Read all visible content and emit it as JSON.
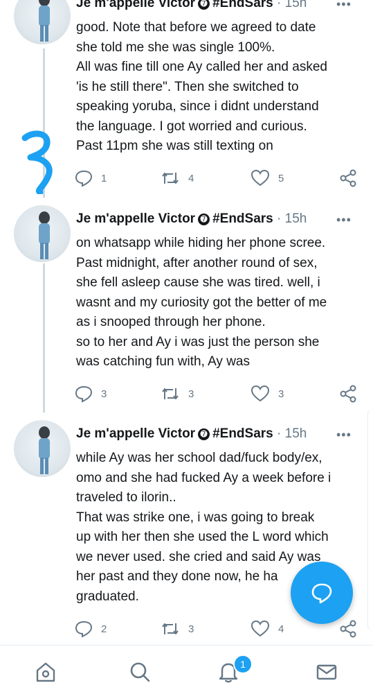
{
  "tweets": [
    {
      "name": "Je m'appelle Victor",
      "tag": "#EndSars",
      "sep": "·",
      "time": "15h",
      "lines": [
        "good. Note that before we agreed to date",
        "she told me she was single 100%.",
        "All was fine till one Ay called her and asked",
        "'is he still there\". Then she switched to",
        "speaking yoruba, since i didnt understand",
        "the language. I got worried and curious.",
        "Past 11pm she was still texting on"
      ],
      "replies": "1",
      "retweets": "4",
      "likes": "5"
    },
    {
      "name": "Je m'appelle Victor",
      "tag": "#EndSars",
      "sep": "·",
      "time": "15h",
      "lines": [
        "on whatsapp while hiding her phone scree.",
        "Past midnight, after another round of sex,",
        "she fell asleep cause she was tired. well, i",
        "wasnt and my curiosity got the better of me",
        "as i snooped through her phone.",
        "so to her and Ay i was just the person she",
        "was catching fun with, Ay was"
      ],
      "replies": "3",
      "retweets": "3",
      "likes": "3"
    },
    {
      "name": "Je m'appelle Victor",
      "tag": "#EndSars",
      "sep": "·",
      "time": "15h",
      "lines": [
        "while Ay was her school dad/fuck body/ex,",
        "omo and she had fucked Ay a week before i",
        "traveled to ilorin..",
        "That was strike one, i was going to break",
        "up with her then she used the L word which",
        "we never used. she cried and said Ay was",
        "her past and they done now, he ha",
        "graduated."
      ],
      "replies": "2",
      "retweets": "3",
      "likes": "4"
    }
  ],
  "badge_glyph": "➐",
  "more_glyph": "•••",
  "notifications_count": "1",
  "icons": {
    "reply": "reply-icon",
    "retweet": "retweet-icon",
    "like": "heart-icon",
    "share": "share-icon",
    "compose": "compose-reply-icon",
    "home": "home-icon",
    "search": "search-icon",
    "notifications": "bell-icon",
    "messages": "mail-icon"
  },
  "colors": {
    "accent": "#1da1f2",
    "text": "#14171a",
    "muted": "#657786",
    "annotation": "#1da1f2"
  }
}
